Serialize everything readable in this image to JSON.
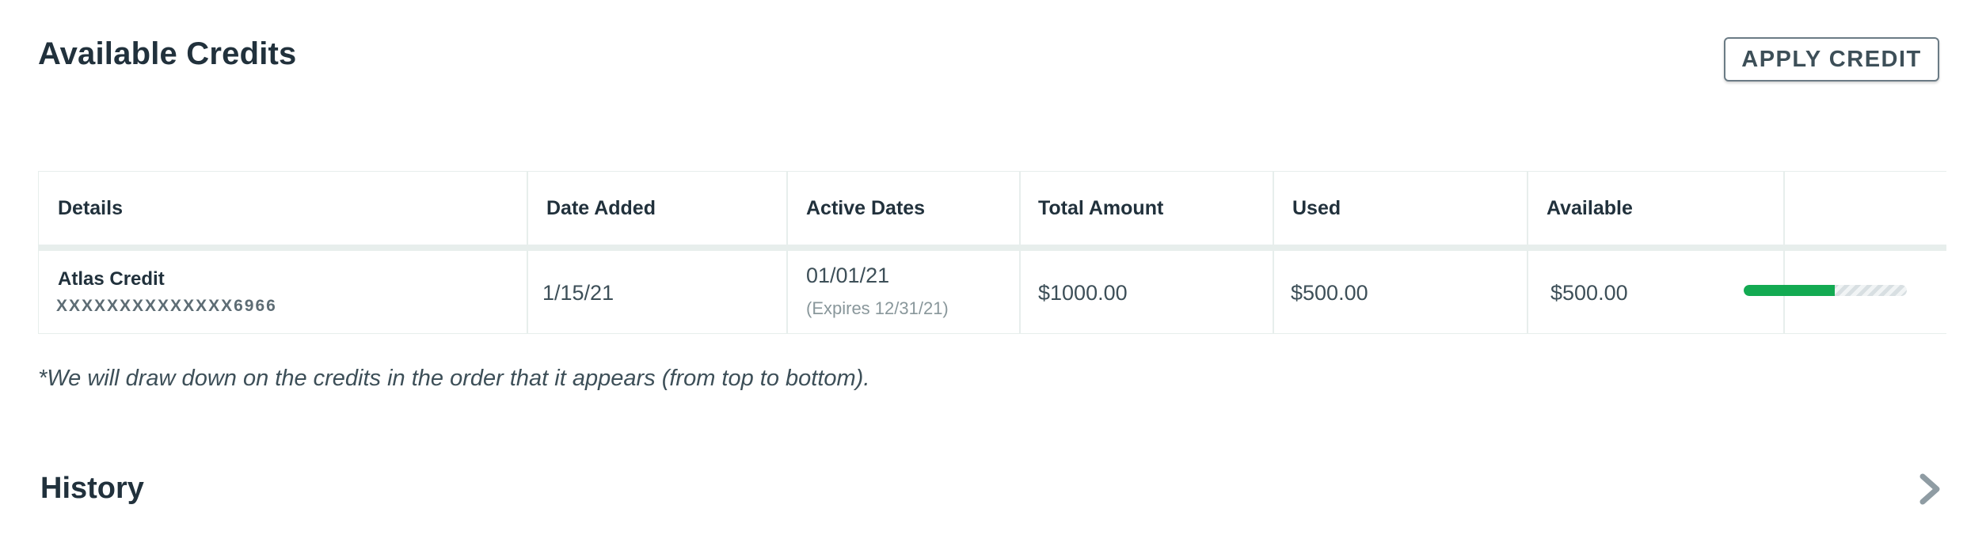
{
  "credits": {
    "title": "Available Credits",
    "apply_button": "APPLY CREDIT",
    "table": {
      "headers": [
        "Details",
        "Date Added",
        "Active Dates",
        "Total Amount",
        "Used",
        "Available"
      ],
      "rows": [
        {
          "name": "Atlas Credit",
          "id": "XXXXXXXXXXXXXX6966",
          "date_added": "1/15/21",
          "active_start": "01/01/21",
          "expires": "(Expires 12/31/21)",
          "total": "$1000.00",
          "used": "$500.00",
          "available": "$500.00",
          "used_fraction": 0.56
        }
      ]
    },
    "note": "*We will draw down on the credits in the order that it appears (from top to bottom)."
  },
  "history": {
    "title": "History"
  },
  "colors": {
    "progress_fill": "#13aa52",
    "text_primary": "#21313c"
  },
  "icons": {
    "expand": "chevron-right-icon"
  }
}
